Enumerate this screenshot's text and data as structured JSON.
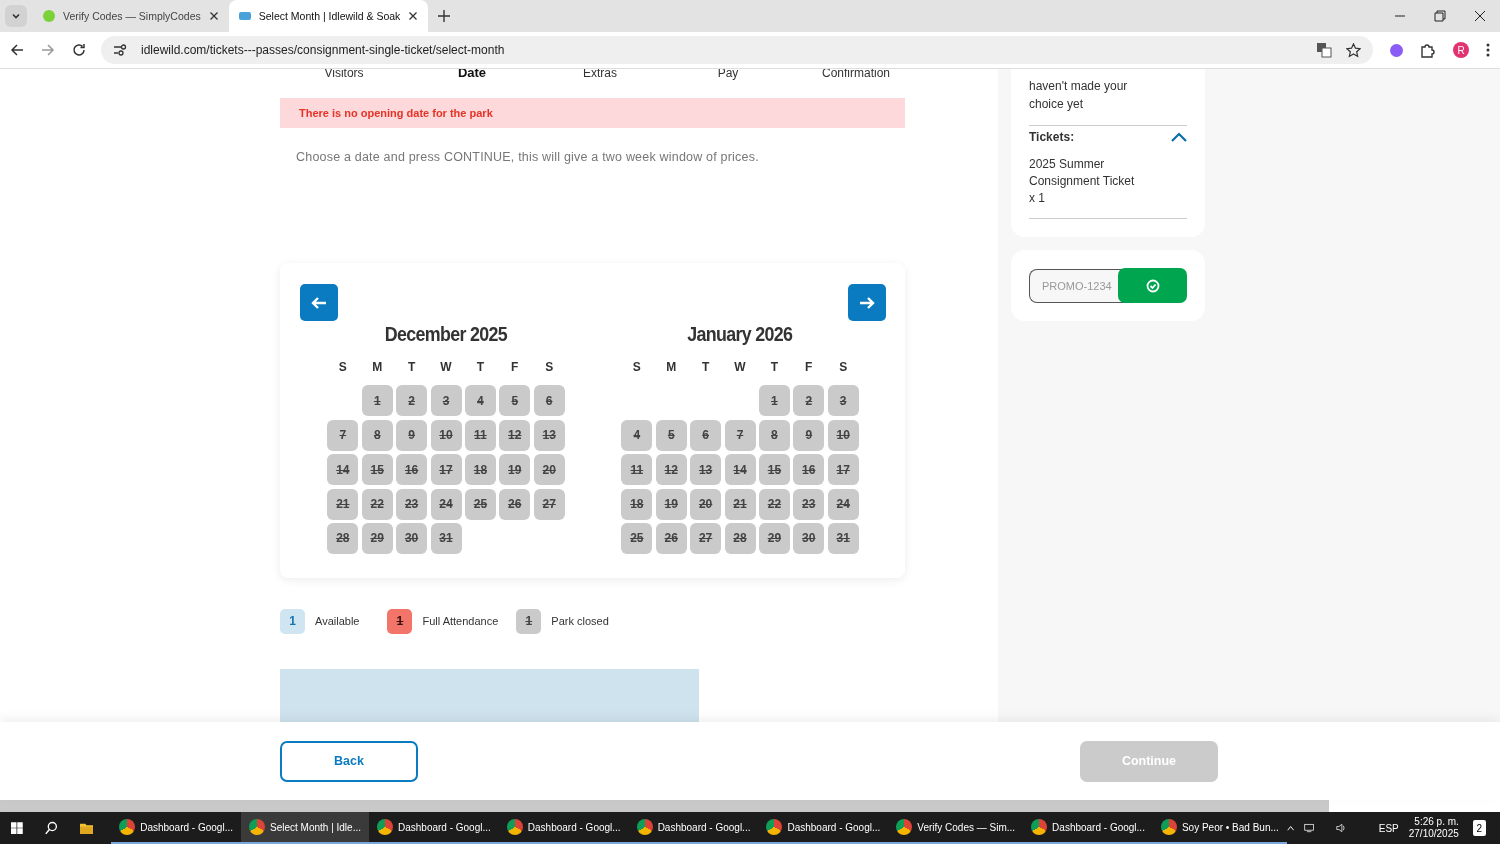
{
  "browser": {
    "tabs": [
      {
        "title": "Verify Codes — SimplyCodes",
        "selected": false
      },
      {
        "title": "Select Month | Idlewild & Soak",
        "selected": true
      }
    ],
    "url": "idlewild.com/tickets---passes/consignment-single-ticket/select-month",
    "profile_initial": "R"
  },
  "steps": [
    {
      "label": "Visitors",
      "selected": false
    },
    {
      "label": "Date",
      "selected": true
    },
    {
      "label": "Extras",
      "selected": false
    },
    {
      "label": "Pay",
      "selected": false
    },
    {
      "label": "Confirmation",
      "selected": false
    }
  ],
  "alert": "There is no opening date for the park",
  "instructions": "Choose a date and press CONTINUE, this will give a two week window of prices.",
  "calendar": {
    "months": [
      {
        "title": "December 2025",
        "weekdays": [
          "S",
          "M",
          "T",
          "W",
          "T",
          "F",
          "S"
        ],
        "weeks": [
          [
            {
              "kind": "blank"
            },
            {
              "d": "1",
              "kind": "closed"
            },
            {
              "d": "2",
              "kind": "closed"
            },
            {
              "d": "3",
              "kind": "closed"
            },
            {
              "d": "4",
              "kind": "closed"
            },
            {
              "d": "5",
              "kind": "closed"
            },
            {
              "d": "6",
              "kind": "closed"
            }
          ],
          [
            {
              "d": "7",
              "kind": "closed"
            },
            {
              "d": "8",
              "kind": "closed"
            },
            {
              "d": "9",
              "kind": "closed"
            },
            {
              "d": "10",
              "kind": "closed"
            },
            {
              "d": "11",
              "kind": "closed"
            },
            {
              "d": "12",
              "kind": "closed"
            },
            {
              "d": "13",
              "kind": "closed"
            }
          ],
          [
            {
              "d": "14",
              "kind": "closed"
            },
            {
              "d": "15",
              "kind": "closed"
            },
            {
              "d": "16",
              "kind": "closed"
            },
            {
              "d": "17",
              "kind": "closed"
            },
            {
              "d": "18",
              "kind": "closed"
            },
            {
              "d": "19",
              "kind": "closed"
            },
            {
              "d": "20",
              "kind": "closed"
            }
          ],
          [
            {
              "d": "21",
              "kind": "closed"
            },
            {
              "d": "22",
              "kind": "closed"
            },
            {
              "d": "23",
              "kind": "closed"
            },
            {
              "d": "24",
              "kind": "closed"
            },
            {
              "d": "25",
              "kind": "closed"
            },
            {
              "d": "26",
              "kind": "closed"
            },
            {
              "d": "27",
              "kind": "closed"
            }
          ],
          [
            {
              "d": "28",
              "kind": "closed"
            },
            {
              "d": "29",
              "kind": "closed"
            },
            {
              "d": "30",
              "kind": "closed"
            },
            {
              "d": "31",
              "kind": "closed"
            }
          ]
        ]
      },
      {
        "title": "January 2026",
        "weekdays": [
          "S",
          "M",
          "T",
          "W",
          "T",
          "F",
          "S"
        ],
        "weeks": [
          [
            {
              "kind": "blank"
            },
            {
              "kind": "blank"
            },
            {
              "kind": "blank"
            },
            {
              "kind": "blank"
            },
            {
              "d": "1",
              "kind": "closed"
            },
            {
              "d": "2",
              "kind": "closed"
            },
            {
              "d": "3",
              "kind": "closed"
            }
          ],
          [
            {
              "d": "4",
              "kind": "closed"
            },
            {
              "d": "5",
              "kind": "closed"
            },
            {
              "d": "6",
              "kind": "closed"
            },
            {
              "d": "7",
              "kind": "closed"
            },
            {
              "d": "8",
              "kind": "closed"
            },
            {
              "d": "9",
              "kind": "closed"
            },
            {
              "d": "10",
              "kind": "closed"
            }
          ],
          [
            {
              "d": "11",
              "kind": "closed"
            },
            {
              "d": "12",
              "kind": "closed"
            },
            {
              "d": "13",
              "kind": "closed"
            },
            {
              "d": "14",
              "kind": "closed"
            },
            {
              "d": "15",
              "kind": "closed"
            },
            {
              "d": "16",
              "kind": "closed"
            },
            {
              "d": "17",
              "kind": "closed"
            }
          ],
          [
            {
              "d": "18",
              "kind": "closed"
            },
            {
              "d": "19",
              "kind": "closed"
            },
            {
              "d": "20",
              "kind": "closed"
            },
            {
              "d": "21",
              "kind": "closed"
            },
            {
              "d": "22",
              "kind": "closed"
            },
            {
              "d": "23",
              "kind": "closed"
            },
            {
              "d": "24",
              "kind": "closed"
            }
          ],
          [
            {
              "d": "25",
              "kind": "closed"
            },
            {
              "d": "26",
              "kind": "closed"
            },
            {
              "d": "27",
              "kind": "closed"
            },
            {
              "d": "28",
              "kind": "closed"
            },
            {
              "d": "29",
              "kind": "closed"
            },
            {
              "d": "30",
              "kind": "closed"
            },
            {
              "d": "31",
              "kind": "closed"
            }
          ]
        ]
      }
    ]
  },
  "legend": [
    {
      "sample": "1",
      "label": "Available",
      "kind": "available"
    },
    {
      "sample": "1",
      "label": "Full Attendance",
      "kind": "full"
    },
    {
      "sample": "1",
      "label": "Park closed",
      "kind": "closed"
    }
  ],
  "summary": {
    "message_lines": [
      "haven't made your",
      "choice yet"
    ],
    "tickets_heading": "Tickets:",
    "expanded": true,
    "ticket_lines": [
      "2025 Summer",
      "Consignment Ticket",
      "x 1"
    ]
  },
  "promo": {
    "placeholder": "PROMO-1234"
  },
  "footer_buttons": [
    {
      "label": "Back",
      "disabled": false
    },
    {
      "label": "Continue",
      "disabled": true
    }
  ],
  "taskbar": {
    "items": [
      {
        "title": "Dashboard - Googl...",
        "selected": false
      },
      {
        "title": "Select Month | Idle...",
        "selected": true
      },
      {
        "title": "Dashboard - Googl...",
        "selected": false
      },
      {
        "title": "Dashboard - Googl...",
        "selected": false
      },
      {
        "title": "Dashboard - Googl...",
        "selected": false
      },
      {
        "title": "Dashboard - Googl...",
        "selected": false
      },
      {
        "title": "Verify Codes — Sim...",
        "selected": false
      },
      {
        "title": "Dashboard - Googl...",
        "selected": false
      },
      {
        "title": "Soy Peor • Bad Bun...",
        "selected": false
      }
    ],
    "language": "ESP",
    "time": "5:26 p. m.",
    "date": "27/10/2025",
    "notifications": "2"
  }
}
